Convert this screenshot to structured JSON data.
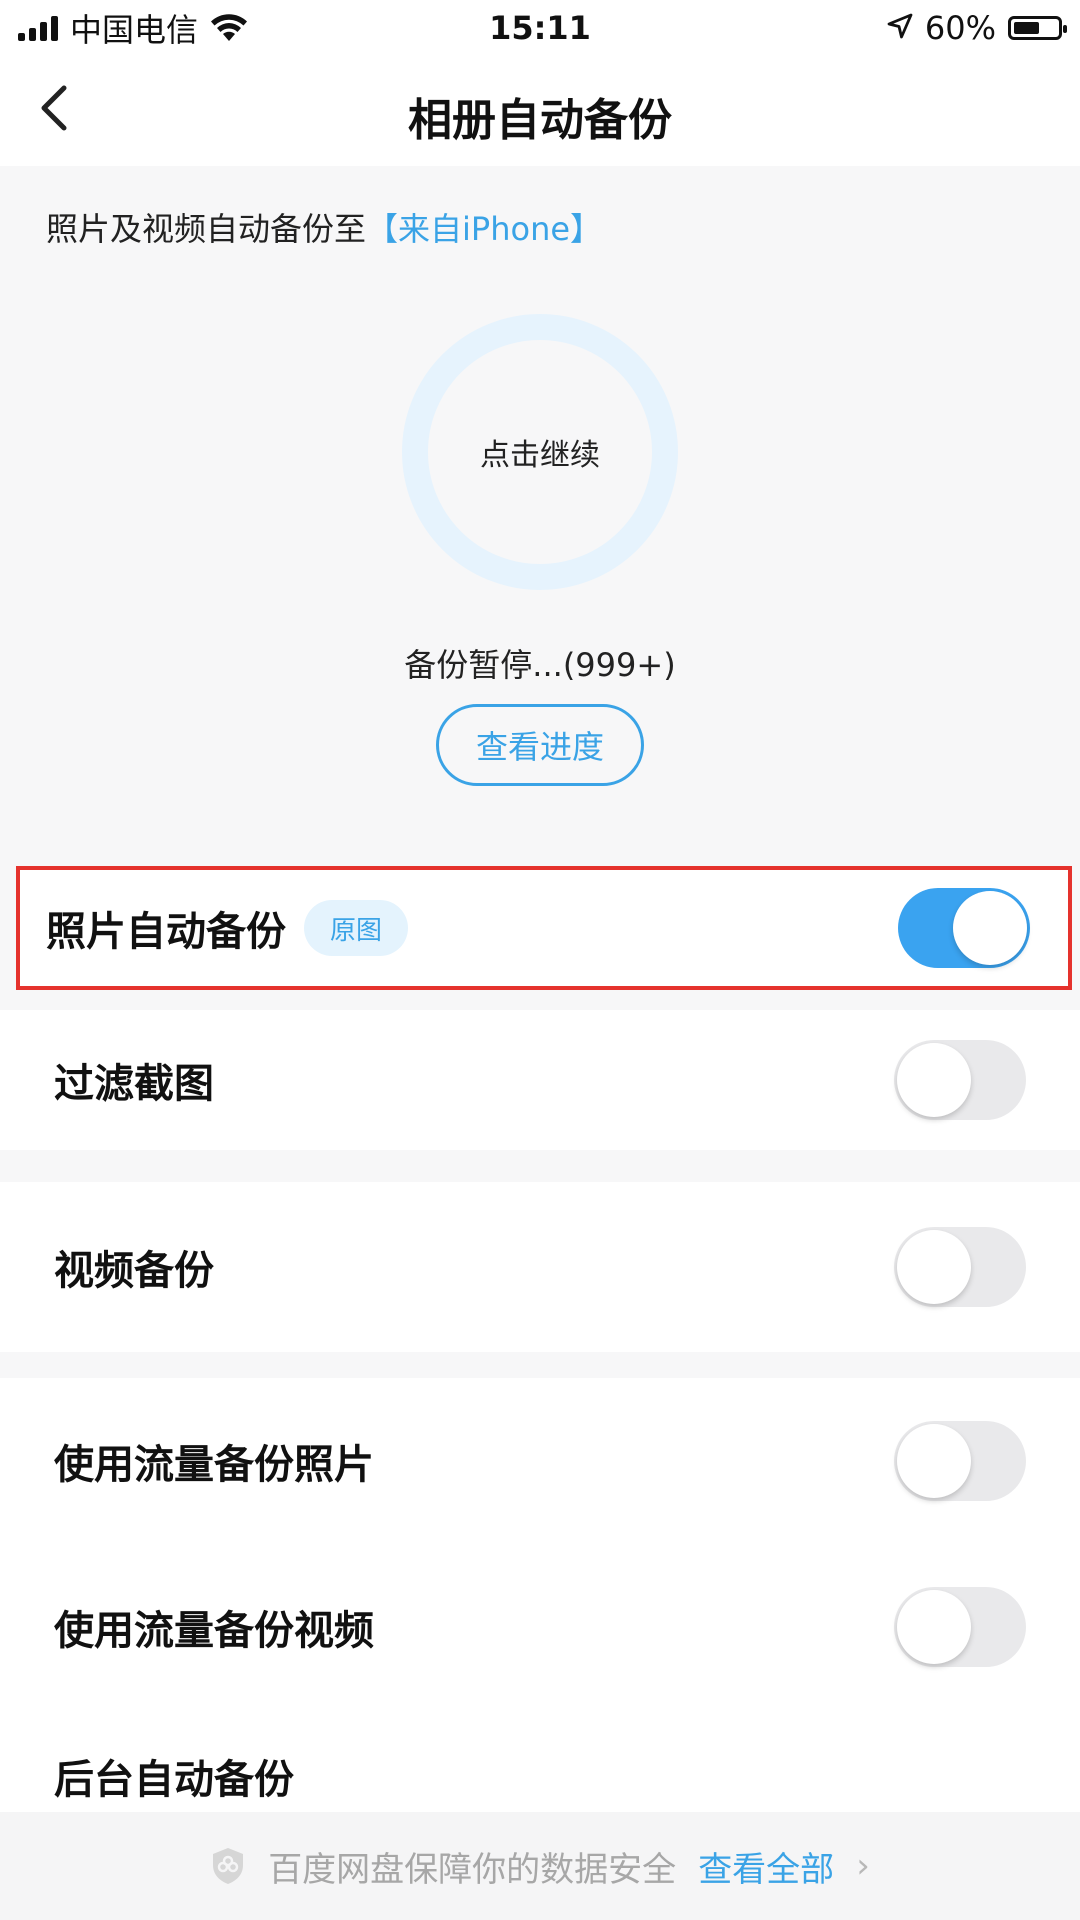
{
  "status_bar": {
    "carrier": "中国电信",
    "time": "15:11",
    "battery": "60%",
    "battery_level": 0.6
  },
  "header": {
    "title": "相册自动备份",
    "back_icon": "chevron-left-icon"
  },
  "summary": {
    "destination_prefix": "照片及视频自动备份至",
    "destination_name": "【来自iPhone】",
    "ring_label": "点击继续",
    "status": "备份暂停...(999+)",
    "progress_button": "查看进度"
  },
  "settings": {
    "photo_auto_backup": {
      "label": "照片自动备份",
      "badge": "原图",
      "enabled": true
    },
    "filter_screenshots": {
      "label": "过滤截图",
      "enabled": false
    },
    "video_backup": {
      "label": "视频备份",
      "enabled": false
    },
    "mobile_data_photos": {
      "label": "使用流量备份照片",
      "enabled": false
    },
    "mobile_data_videos": {
      "label": "使用流量备份视频",
      "enabled": false
    },
    "background_backup": {
      "label": "后台自动备份",
      "enabled": false
    }
  },
  "footer": {
    "security_text": "百度网盘保障你的数据安全",
    "view_all": "查看全部",
    "chevron": "›"
  },
  "colors": {
    "accent": "#3aa3e6",
    "toggle_on": "#3aa3f0",
    "highlight": "#e5322d",
    "ring": "#e6f3fd"
  }
}
